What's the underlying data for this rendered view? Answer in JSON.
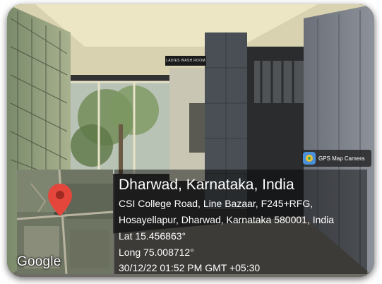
{
  "photo": {
    "sign_text": "LADIES WASH ROOM"
  },
  "badge": {
    "label": "GPS Map Camera",
    "icon": "gps-map-camera-icon"
  },
  "map": {
    "attribution": "Google",
    "marker_color": "#e5463b"
  },
  "overlay": {
    "title": "Dharwad, Karnataka, India",
    "address_line1": "CSI College Road, Line Bazaar, F245+RFG,",
    "address_line2": "Hosayellapur, Dharwad, Karnataka 580001, India",
    "latitude": "Lat 15.456863°",
    "longitude": "Long 75.008712°",
    "timestamp": "30/12/22 01:52 PM GMT +05:30"
  }
}
